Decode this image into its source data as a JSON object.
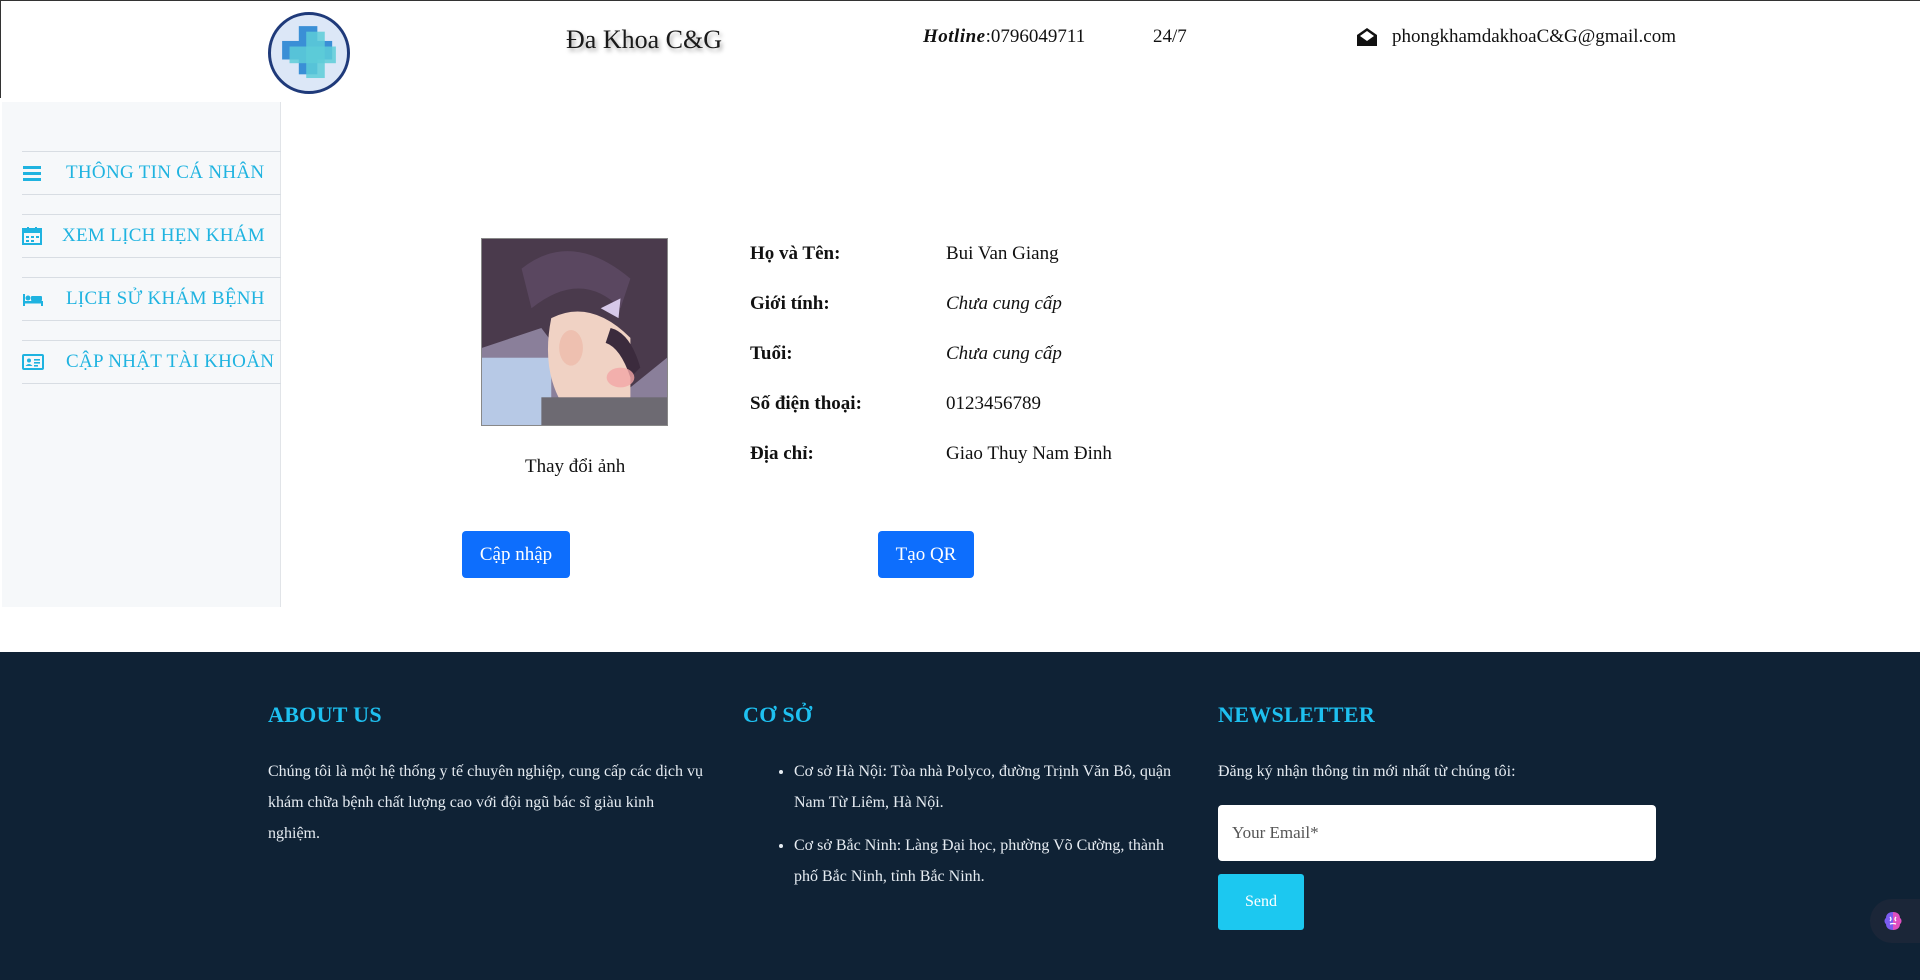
{
  "header": {
    "brand": "Đa Khoa C&G",
    "hotline_label": "Hotline",
    "hotline_number": ":0796049711",
    "hours": "24/7",
    "email": "phongkhamdakhoaC&G@gmail.com"
  },
  "sidebar": {
    "items": [
      {
        "label": "THÔNG TIN CÁ NHÂN",
        "icon": "menu-icon"
      },
      {
        "label": "XEM LỊCH HẸN KHÁM",
        "icon": "calendar-icon"
      },
      {
        "label": "LỊCH SỬ KHÁM BỆNH",
        "icon": "bed-icon"
      },
      {
        "label": "CẬP NHẬT TÀI KHOẢN",
        "icon": "id-card-icon"
      }
    ]
  },
  "profile": {
    "change_photo": "Thay đổi ảnh",
    "fields": [
      {
        "label": "Họ và Tên:",
        "value": "Bui Van Giang"
      },
      {
        "label": "Giới tính:",
        "value": "Chưa cung cấp"
      },
      {
        "label": "Tuổi:",
        "value": "Chưa cung cấp"
      },
      {
        "label": "Số điện thoại:",
        "value": "0123456789"
      },
      {
        "label": "Địa chỉ:",
        "value": "Giao Thuy Nam Đinh"
      }
    ],
    "update_button": "Cập nhập",
    "qr_button": "Tạo QR"
  },
  "footer": {
    "about_title": "ABOUT US",
    "about_text": "Chúng tôi là một hệ thống y tế chuyên nghiệp, cung cấp các dịch vụ khám chữa bệnh chất lượng cao với đội ngũ bác sĩ giàu kinh nghiệm.",
    "branches_title": "CƠ SỞ",
    "branches": [
      "Cơ sở Hà Nội: Tòa nhà Polyco, đường Trịnh Văn Bô, quận Nam Từ Liêm, Hà Nội.",
      "Cơ sở Bắc Ninh: Làng Đại học, phường Võ Cường, thành phố Bắc Ninh, tỉnh Bắc Ninh."
    ],
    "newsletter_title": "NEWSLETTER",
    "newsletter_text": "Đăng ký nhận thông tin mới nhất từ chúng tôi:",
    "email_placeholder": "Your Email*",
    "send_button": "Send"
  },
  "colors": {
    "accent": "#1fb3e0",
    "primary_button": "#0d6efd",
    "footer_bg": "#0f2235",
    "footer_heading": "#1ec0f0"
  }
}
